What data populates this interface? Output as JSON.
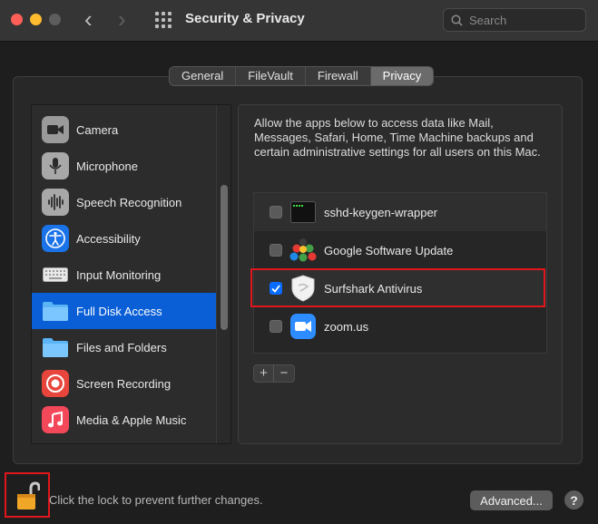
{
  "window": {
    "title": "Security & Privacy",
    "search_placeholder": "Search"
  },
  "tabs": [
    {
      "label": "General",
      "active": false
    },
    {
      "label": "FileVault",
      "active": false
    },
    {
      "label": "Firewall",
      "active": false
    },
    {
      "label": "Privacy",
      "active": true
    }
  ],
  "sidebar": {
    "items": [
      {
        "label": "Camera",
        "icon": "camera-icon",
        "selected": false
      },
      {
        "label": "Microphone",
        "icon": "microphone-icon",
        "selected": false
      },
      {
        "label": "Speech Recognition",
        "icon": "speech-waveform-icon",
        "selected": false
      },
      {
        "label": "Accessibility",
        "icon": "accessibility-icon",
        "selected": false
      },
      {
        "label": "Input Monitoring",
        "icon": "keyboard-icon",
        "selected": false
      },
      {
        "label": "Full Disk Access",
        "icon": "folder-icon",
        "selected": true
      },
      {
        "label": "Files and Folders",
        "icon": "folder-icon",
        "selected": false
      },
      {
        "label": "Screen Recording",
        "icon": "screen-recording-icon",
        "selected": false
      },
      {
        "label": "Media & Apple Music",
        "icon": "music-icon",
        "selected": false
      }
    ]
  },
  "content": {
    "description": "Allow the apps below to access data like Mail, Messages, Safari, Home, Time Machine backups and certain administrative settings for all users on this Mac.",
    "apps": [
      {
        "label": "sshd-keygen-wrapper",
        "icon": "terminal-icon",
        "checked": false
      },
      {
        "label": "Google Software Update",
        "icon": "google-update-icon",
        "checked": false
      },
      {
        "label": "Surfshark Antivirus",
        "icon": "surfshark-shield-icon",
        "checked": true
      },
      {
        "label": "zoom.us",
        "icon": "zoom-icon",
        "checked": false
      }
    ],
    "add_label": "+",
    "remove_label": "−"
  },
  "footer": {
    "lock_text": "Click the lock to prevent further changes.",
    "advanced_label": "Advanced...",
    "help_label": "?"
  },
  "colors": {
    "accent": "#0a5fd6",
    "highlight": "#e0161c"
  }
}
